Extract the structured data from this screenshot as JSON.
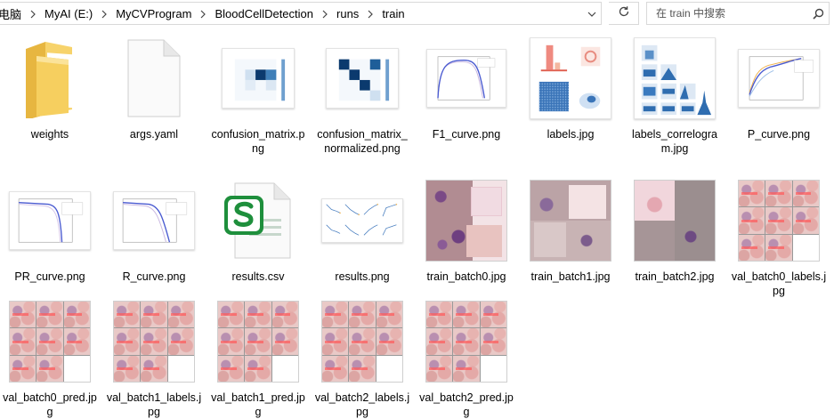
{
  "address": {
    "crumbs": [
      "电脑",
      "MyAI (E:)",
      "MyCVProgram",
      "BloodCellDetection",
      "runs",
      "train"
    ]
  },
  "search": {
    "placeholder": "在 train 中搜索"
  },
  "colors": {
    "folder": "#f2c14e",
    "csv_green": "#1e8f3c",
    "line_blue": "#4a5bd1",
    "heat_dark": "#0b3a6e"
  },
  "files": [
    {
      "name": "weights",
      "kind": "folder",
      "icon": "folder-icon"
    },
    {
      "name": "args.yaml",
      "kind": "blank-doc",
      "icon": "document-icon"
    },
    {
      "name": "confusion_matrix.png",
      "kind": "confmat"
    },
    {
      "name": "confusion_matrix_normalized.png",
      "kind": "confmat2"
    },
    {
      "name": "F1_curve.png",
      "kind": "curve"
    },
    {
      "name": "labels.jpg",
      "kind": "labels"
    },
    {
      "name": "labels_correlogram.jpg",
      "kind": "correlogram"
    },
    {
      "name": "P_curve.png",
      "kind": "curve"
    },
    {
      "name": "PR_curve.png",
      "kind": "pr"
    },
    {
      "name": "R_curve.png",
      "kind": "pr"
    },
    {
      "name": "results.csv",
      "kind": "csv",
      "icon": "spreadsheet-icon"
    },
    {
      "name": "results.png",
      "kind": "results"
    },
    {
      "name": "train_batch0.jpg",
      "kind": "photo"
    },
    {
      "name": "train_batch1.jpg",
      "kind": "photo"
    },
    {
      "name": "train_batch2.jpg",
      "kind": "photo"
    },
    {
      "name": "val_batch0_labels.jpg",
      "kind": "mosaic"
    },
    {
      "name": "val_batch0_pred.jpg",
      "kind": "mosaic"
    },
    {
      "name": "val_batch1_labels.jpg",
      "kind": "mosaic"
    },
    {
      "name": "val_batch1_pred.jpg",
      "kind": "mosaic"
    },
    {
      "name": "val_batch2_labels.jpg",
      "kind": "mosaic"
    },
    {
      "name": "val_batch2_pred.jpg",
      "kind": "mosaic"
    }
  ]
}
